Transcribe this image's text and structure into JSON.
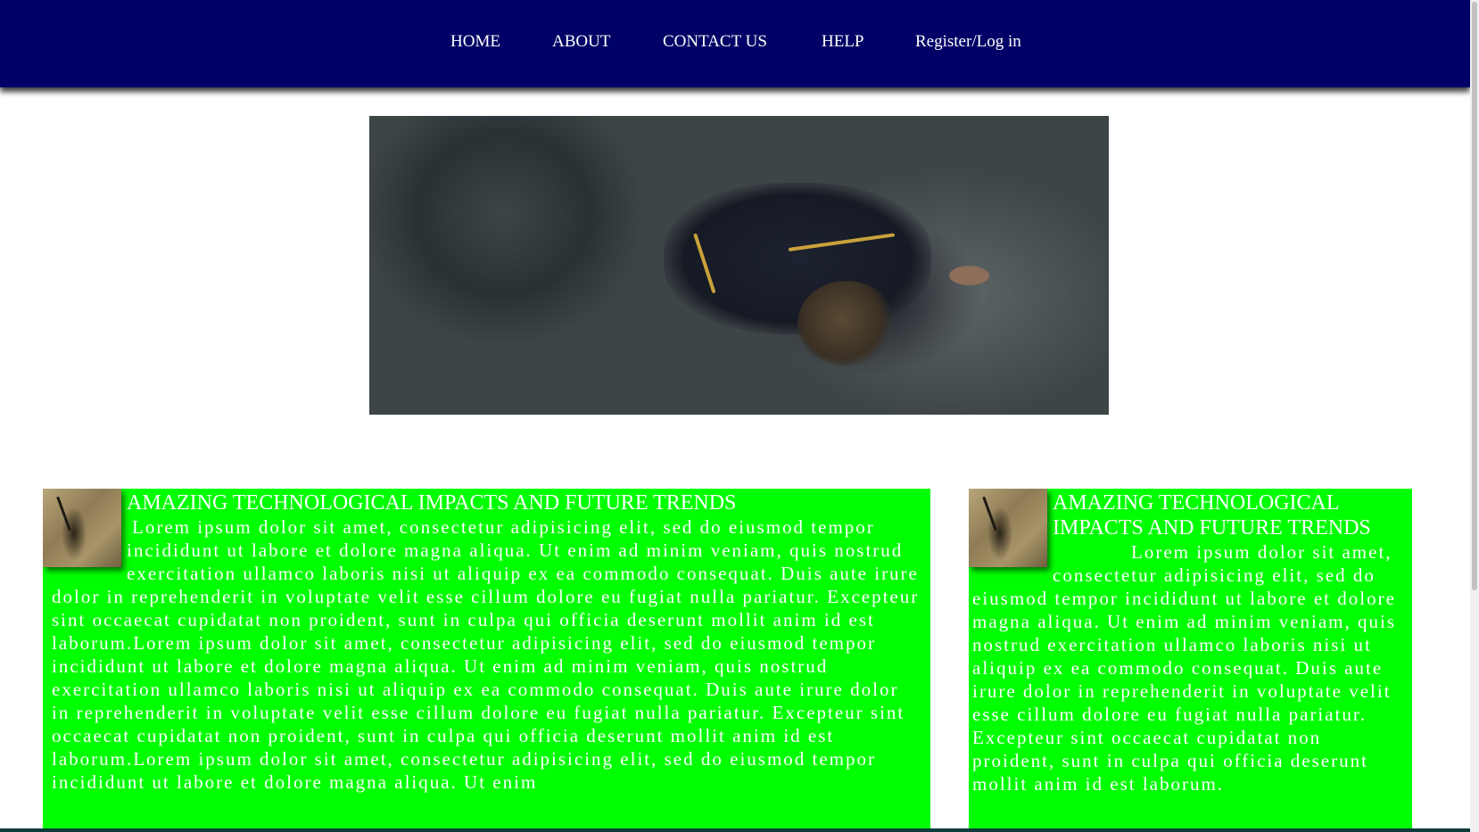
{
  "nav": {
    "items": [
      {
        "label": "HOME"
      },
      {
        "label": "ABOUT"
      },
      {
        "label": "CONTACT US"
      },
      {
        "label": "HELP"
      },
      {
        "label": "Register/Log in"
      }
    ]
  },
  "hero": {
    "image": "person-lying-on-rocks-photo"
  },
  "articles": [
    {
      "thumbnail": "rock-climbing-thumbnail",
      "title": "AMAZING TECHNOLOGICAL IMPACTS AND FUTURE TRENDS",
      "body": "Lorem ipsum dolor sit amet, consectetur adipisicing elit, sed do eiusmod tempor incididunt ut labore et dolore magna aliqua. Ut enim ad minim veniam, quis nostrud exercitation ullamco laboris nisi ut aliquip ex ea commodo consequat. Duis aute irure dolor in reprehenderit in voluptate velit esse cillum dolore eu fugiat nulla pariatur. Excepteur sint occaecat cupidatat non proident, sunt in culpa qui officia deserunt mollit anim id est laborum.Lorem ipsum dolor sit amet, consectetur adipisicing elit, sed do eiusmod tempor incididunt ut labore et dolore magna aliqua. Ut enim ad minim veniam, quis nostrud exercitation ullamco laboris nisi ut aliquip ex ea commodo consequat. Duis aute irure dolor in reprehenderit in voluptate velit esse cillum dolore eu fugiat nulla pariatur. Excepteur sint occaecat cupidatat non proident, sunt in culpa qui officia deserunt mollit anim id est laborum.Lorem ipsum dolor sit amet, consectetur adipisicing elit, sed do eiusmod tempor incididunt ut labore et dolore magna aliqua. Ut enim"
    },
    {
      "thumbnail": "rock-climbing-thumbnail",
      "title": "AMAZING TECHNOLOGICAL IMPACTS AND FUTURE TRENDS",
      "body": "Lorem ipsum dolor sit amet, consectetur adipisicing elit, sed do eiusmod tempor incididunt ut labore et dolore magna aliqua. Ut enim ad minim veniam, quis nostrud exercitation ullamco laboris nisi ut aliquip ex ea commodo consequat. Duis aute irure dolor in reprehenderit in voluptate velit esse cillum dolore eu fugiat nulla pariatur. Excepteur sint occaecat cupidatat non proident, sunt in culpa qui officia deserunt mollit anim id est laborum."
    }
  ],
  "colors": {
    "navbar": "#000066",
    "card": "#00ff00",
    "text": "#ffffff"
  }
}
